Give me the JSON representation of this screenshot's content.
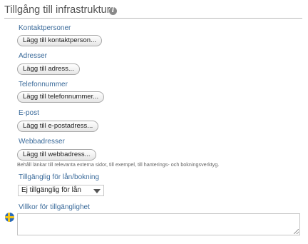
{
  "section": {
    "title": "Tillgång till infrastruktur",
    "help_icon": "help-icon"
  },
  "fields": {
    "contacts": {
      "label": "Kontaktpersoner",
      "button": "Lägg till kontaktperson..."
    },
    "addresses": {
      "label": "Adresser",
      "button": "Lägg till adress..."
    },
    "phones": {
      "label": "Telefonnummer",
      "button": "Lägg till telefonnummer..."
    },
    "emails": {
      "label": "E-post",
      "button": "Lägg till e-postadress..."
    },
    "websites": {
      "label": "Webbadresser",
      "button": "Lägg till webbadress...",
      "help": "Behåll länkar till relevanta externa sidor, till exempel, till hanterings- och bokningsverktyg."
    },
    "availability": {
      "label": "Tillgänglig för lån/bokning",
      "selected": "Ej tillgänglig för lån"
    },
    "conditions": {
      "label": "Villkor för tillgänglighet",
      "value": "",
      "language_icon": "swedish-flag-icon"
    }
  }
}
